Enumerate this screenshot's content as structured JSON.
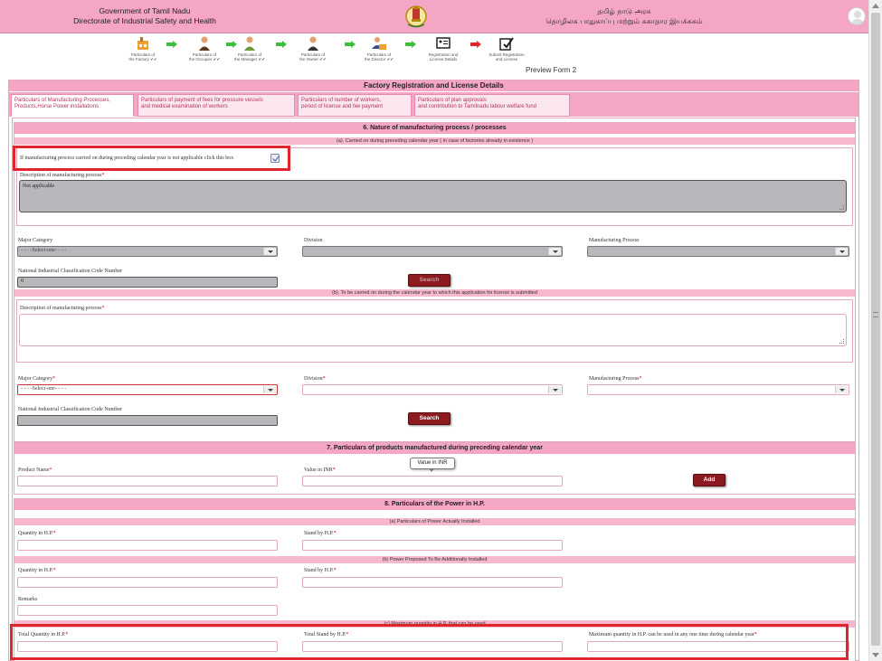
{
  "header": {
    "en_line1": "Government of Tamil Nadu",
    "en_line2": "Directorate of Industrial Safety and Health",
    "ta_line1": "தமிழ் நாடு அரசு",
    "ta_line2": "தொழிலக பாதுகாப்பு மற்றும் சுகாதார இயக்ககம்"
  },
  "steps": [
    {
      "label1": "Particulars of",
      "label2": "the Factory ✔✔"
    },
    {
      "label1": "Particulars of",
      "label2": "the Occupier ✔✔"
    },
    {
      "label1": "Particulars of",
      "label2": "the Manager ✔✔"
    },
    {
      "label1": "Particulars of",
      "label2": "the Owner ✔✔"
    },
    {
      "label1": "Particulars of",
      "label2": "the Director ✔✔"
    },
    {
      "label1": "Registration and",
      "label2": "License Details"
    },
    {
      "label1": "Submit Registration",
      "label2": "and License"
    }
  ],
  "preview_label": "Preview Form 2",
  "card_title": "Factory Registration and License Details",
  "tabs": [
    {
      "line1": "Particulars of Manufacturing Processes,",
      "line2": "Products,Horse Power installations"
    },
    {
      "line1": "Particulars of payment of fees for pressure vessels",
      "line2": "and medical examination of workers"
    },
    {
      "line1": "Particulars of number of workers,",
      "line2": "period of license and fee payment"
    },
    {
      "line1": "Particulars of plan approvals",
      "line2": "and contribution to Tamilnadu labour welfare fund"
    }
  ],
  "sec6": {
    "title": "6. Nature of manufacturing process / processes",
    "sub_a": "(a). Carried on during preceding calendar year ( in case of factories already in existence )",
    "checkbox_label": "If manufacturing process carried on during preceding calendar year is not applicable click this box",
    "desc_label": "Description of manufacturing process",
    "desc_value": "Not applicable",
    "major_label": "Major Category",
    "division_label": "Division",
    "process_label": "Manufacturing Process",
    "select_placeholder": "- - - -Select-one- - - -",
    "nic_label": "National Industrial Classification Code Number",
    "nic_value": "0",
    "search_label": "Search",
    "sub_b": "(b). To be carried on during the calendar year to which this application for license is submitted",
    "desc2_label": "Description of manufacturing process",
    "major2_label": "Major Category",
    "division2_label": "Division",
    "process2_label": "Manufacturing Process",
    "nic2_label": "National Industrial Classification Code Number",
    "search2_label": "Search",
    "required_mark": "*"
  },
  "sec7": {
    "title": "7. Particulars of products manufactured during preceding calendar year",
    "product_label": "Product Name",
    "value_label": "Value in INR",
    "tooltip": "Value in INR",
    "add_label": "Add"
  },
  "sec8": {
    "title": "8. Particulars of the Power in H.P.",
    "sub_a": "(a) Particulars of Power Actually Installed",
    "qty_label": "Quantity in H.P.",
    "standby_label": "Stand by H.P.",
    "sub_b": "(b) Power Proposed To Be Additionally Installed",
    "qty2_label": "Quantity in H.P.",
    "standby2_label": "Stand by H.P.",
    "remarks_label": "Remarks",
    "sub_c": "(c) Maximum quantity in H.P. that can be used",
    "total_qty_label": "Total Quantity in H.P.",
    "total_standby_label": "Total Stand by H.P.",
    "max_label": "Maximum quantity in H.P. can be used in any one time during calendar year"
  },
  "colors": {
    "pink": "#f4a6c4",
    "maroon": "#8c1a1f",
    "highlight": "#e0262d"
  }
}
